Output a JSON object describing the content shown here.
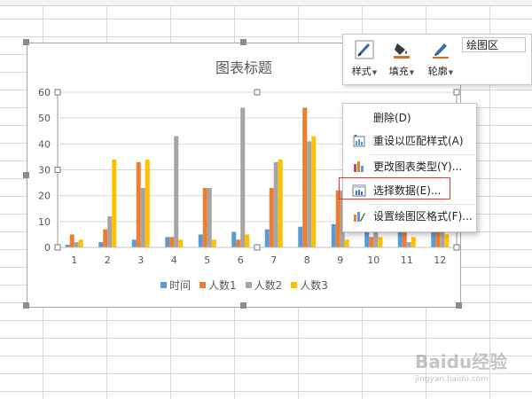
{
  "chart": {
    "title": "图表标题",
    "legend_entries": [
      "时间",
      "人数1",
      "人数2",
      "人数3"
    ]
  },
  "chart_data": {
    "type": "bar",
    "title": "图表标题",
    "categories": [
      "1",
      "2",
      "3",
      "4",
      "5",
      "6",
      "7",
      "8",
      "9",
      "10",
      "11",
      "12"
    ],
    "series": [
      {
        "name": "时间",
        "color": "#5b9bd5",
        "values": [
          1,
          2,
          3,
          4,
          5,
          6,
          7,
          8,
          9,
          10,
          11,
          12
        ]
      },
      {
        "name": "人数1",
        "color": "#ed7d31",
        "values": [
          5,
          7,
          33,
          4,
          23,
          3,
          23,
          54,
          22,
          4,
          11,
          13
        ]
      },
      {
        "name": "人数2",
        "color": "#a5a5a5",
        "values": [
          2,
          12,
          23,
          43,
          23,
          54,
          33,
          41,
          22,
          11,
          2,
          10
        ]
      },
      {
        "name": "人数3",
        "color": "#ffc000",
        "values": [
          3,
          34,
          34,
          3,
          3,
          5,
          34,
          43,
          3,
          4,
          4,
          5
        ]
      }
    ],
    "ylim": [
      0,
      60
    ],
    "yticks": [
      0,
      10,
      20,
      30,
      40,
      50,
      60
    ],
    "grid": true,
    "legend_position": "bottom"
  },
  "toolbar": {
    "style_label": "样式",
    "fill_label": "填充",
    "outline_label": "轮廓",
    "element_select_value": "绘图区"
  },
  "context_menu": {
    "items": [
      {
        "label": "删除(D)",
        "icon": "none"
      },
      {
        "label": "重设以匹配样式(A)",
        "icon": "reset-style-icon"
      },
      {
        "label": "更改图表类型(Y)...",
        "icon": "chart-type-icon"
      },
      {
        "label": "选择数据(E)...",
        "icon": "select-data-icon"
      },
      {
        "label": "设置绘图区格式(F)...",
        "icon": "format-plot-icon"
      }
    ]
  },
  "watermark": {
    "text": "Baidu经验",
    "subtext": "jingyan.baidu.com"
  }
}
